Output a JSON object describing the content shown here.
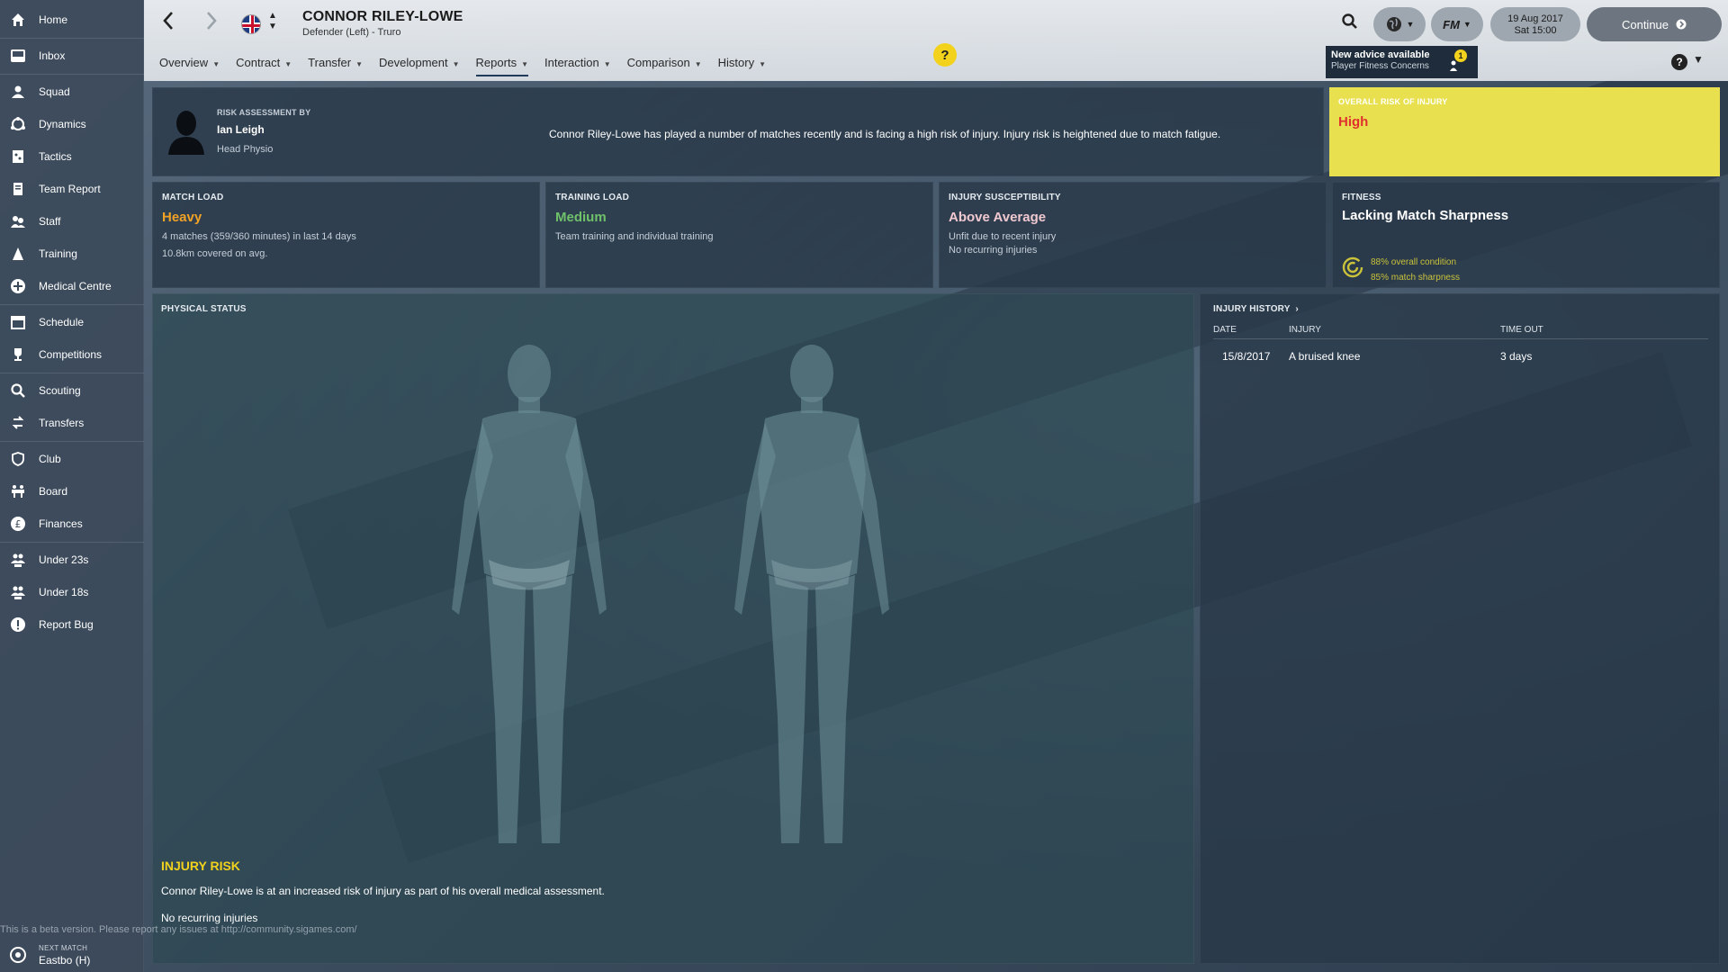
{
  "sidebar": {
    "items": [
      {
        "label": "Home",
        "icon": "home-icon"
      },
      {
        "label": "Inbox",
        "icon": "inbox-icon"
      },
      {
        "label": "Squad",
        "icon": "squad-icon"
      },
      {
        "label": "Dynamics",
        "icon": "dynamics-icon"
      },
      {
        "label": "Tactics",
        "icon": "tactics-icon"
      },
      {
        "label": "Team Report",
        "icon": "report-icon"
      },
      {
        "label": "Staff",
        "icon": "staff-icon"
      },
      {
        "label": "Training",
        "icon": "training-icon"
      },
      {
        "label": "Medical Centre",
        "icon": "medical-icon"
      },
      {
        "label": "Schedule",
        "icon": "calendar-icon"
      },
      {
        "label": "Competitions",
        "icon": "trophy-icon"
      },
      {
        "label": "Scouting",
        "icon": "search-icon"
      },
      {
        "label": "Transfers",
        "icon": "transfers-icon"
      },
      {
        "label": "Club",
        "icon": "shield-icon"
      },
      {
        "label": "Board",
        "icon": "board-icon"
      },
      {
        "label": "Finances",
        "icon": "pound-icon"
      },
      {
        "label": "Under 23s",
        "icon": "u23-icon"
      },
      {
        "label": "Under 18s",
        "icon": "u18-icon"
      },
      {
        "label": "Report Bug",
        "icon": "bug-icon"
      }
    ],
    "next_match": {
      "caption": "NEXT MATCH",
      "value": "Eastbo (H)"
    }
  },
  "header": {
    "player_name": "CONNOR RILEY-LOWE",
    "player_sub": "Defender (Left) - Truro",
    "tabs": [
      "Overview",
      "Contract",
      "Transfer",
      "Development",
      "Reports",
      "Interaction",
      "Comparison",
      "History"
    ],
    "active_tab": "Reports",
    "help_bubble": "?",
    "date_line1": "19 Aug 2017",
    "date_line2": "Sat 15:00",
    "continue_label": "Continue",
    "advice_title": "New advice available",
    "advice_sub": "Player Fitness Concerns",
    "advice_count": "1",
    "help_label": "?"
  },
  "risk_assessment": {
    "caption": "RISK ASSESSMENT BY",
    "name": "Ian Leigh",
    "role": "Head Physio",
    "summary": "Connor Riley-Lowe has played a number of matches recently and is facing a high risk of injury. Injury risk is heightened due to match fatigue."
  },
  "overall_risk": {
    "caption": "OVERALL RISK OF INJURY",
    "level": "High"
  },
  "match_load": {
    "caption": "MATCH LOAD",
    "value": "Heavy",
    "line1": "4 matches (359/360 minutes) in last 14 days",
    "line2": "10.8km covered on avg."
  },
  "training_load": {
    "caption": "TRAINING LOAD",
    "value": "Medium",
    "line1": "Team training and individual training"
  },
  "injury_susceptibility": {
    "caption": "INJURY SUSCEPTIBILITY",
    "value": "Above Average",
    "line1": "Unfit due to recent injury",
    "line2": "No recurring injuries"
  },
  "fitness": {
    "caption": "FITNESS",
    "value": "Lacking Match Sharpness",
    "condition": "88% overall condition",
    "sharpness": "85% match sharpness"
  },
  "physical_status": {
    "caption": "PHYSICAL STATUS",
    "risk_title": "INJURY RISK",
    "risk_text": "Connor Riley-Lowe is at an increased risk of injury as part of his overall medical assessment.",
    "recurring": "No recurring injuries"
  },
  "injury_history": {
    "caption": "INJURY HISTORY",
    "columns": [
      "DATE",
      "INJURY",
      "TIME OUT"
    ],
    "rows": [
      {
        "date": "15/8/2017",
        "injury": "A bruised knee",
        "time_out": "3 days"
      }
    ]
  },
  "footer": {
    "beta_notice": "This is a beta version. Please report any issues at http://community.sigames.com/"
  },
  "colors": {
    "heavy": "#f0a226",
    "medium": "#6fc16a",
    "above_average": "#f0c8d0",
    "high": "#e0312e",
    "overall_bg": "#e9e04f",
    "fitness_ring": "#c9c23a",
    "risk_title": "#f2d21d"
  }
}
